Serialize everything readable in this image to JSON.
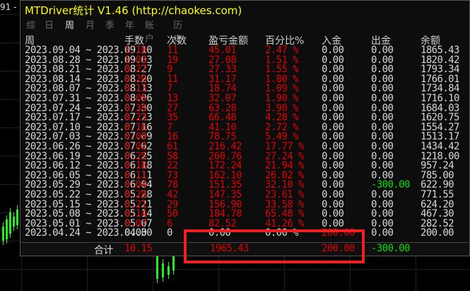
{
  "price_label": "91 -",
  "title": "MTDriver统计 V1.46  (http://chaokes.com)",
  "tabs": [
    {
      "label": "综",
      "active": false
    },
    {
      "label": "日",
      "active": false
    },
    {
      "label": "周",
      "active": true
    },
    {
      "label": "月",
      "active": false
    },
    {
      "label": "季",
      "active": false
    },
    {
      "label": "年",
      "active": false
    },
    {
      "label": "账户",
      "active": false
    },
    {
      "label": "历史",
      "active": false
    }
  ],
  "columns": [
    "周",
    "手数",
    "次数",
    "盈亏金额",
    "百分比%",
    "入金",
    "出金",
    "余额"
  ],
  "rows": [
    {
      "week": "2023.09.04 ~ 2023.09.10",
      "lots": "1.10",
      "count": "11",
      "pnl": "45.01",
      "pct": "2.47 %",
      "dep": "0.00",
      "wd": "0.00",
      "bal": "1865.43"
    },
    {
      "week": "2023.08.28 ~ 2023.09.03",
      "lots": "1.03",
      "count": "19",
      "pnl": "27.08",
      "pct": "1.51 %",
      "dep": "0.00",
      "wd": "0.00",
      "bal": "1820.42"
    },
    {
      "week": "2023.08.21 ~ 2023.08.27",
      "lots": "0.27",
      "count": "9",
      "pnl": "27.33",
      "pct": "1.55 %",
      "dep": "0.00",
      "wd": "0.00",
      "bal": "1793.34"
    },
    {
      "week": "2023.08.14 ~ 2023.08.20",
      "lots": "0.20",
      "count": "11",
      "pnl": "31.17",
      "pct": "1.80 %",
      "dep": "0.00",
      "wd": "0.00",
      "bal": "1766.01"
    },
    {
      "week": "2023.08.07 ~ 2023.08.13",
      "lots": "0.13",
      "count": "7",
      "pnl": "18.74",
      "pct": "1.09 %",
      "dep": "0.00",
      "wd": "0.00",
      "bal": "1734.84"
    },
    {
      "week": "2023.07.31 ~ 2023.08.06",
      "lots": "0.05",
      "count": "13",
      "pnl": "32.07",
      "pct": "1.90 %",
      "dep": "0.00",
      "wd": "0.00",
      "bal": "1716.10"
    },
    {
      "week": "2023.07.24 ~ 2023.07.30",
      "lots": "0.30",
      "count": "27",
      "pnl": "63.28",
      "pct": "3.90 %",
      "dep": "0.00",
      "wd": "0.00",
      "bal": "1684.03"
    },
    {
      "week": "2023.07.17 ~ 2023.07.23",
      "lots": "0.23",
      "count": "35",
      "pnl": "66.48",
      "pct": "4.28 %",
      "dep": "0.00",
      "wd": "0.00",
      "bal": "1620.75"
    },
    {
      "week": "2023.07.10 ~ 2023.07.16",
      "lots": "0.16",
      "count": "7",
      "pnl": "41.10",
      "pct": "2.72 %",
      "dep": "0.00",
      "wd": "0.00",
      "bal": "1554.27"
    },
    {
      "week": "2023.07.03 ~ 2023.07.09",
      "lots": "0.09",
      "count": "16",
      "pnl": "78.75",
      "pct": "5.49 %",
      "dep": "0.00",
      "wd": "0.00",
      "bal": "1513.17"
    },
    {
      "week": "2023.06.26 ~ 2023.07.02",
      "lots": "0.02",
      "count": "61",
      "pnl": "216.42",
      "pct": "17.77 %",
      "dep": "0.00",
      "wd": "0.00",
      "bal": "1434.42"
    },
    {
      "week": "2023.06.19 ~ 2023.06.25",
      "lots": "0.25",
      "count": "58",
      "pnl": "260.76",
      "pct": "27.24 %",
      "dep": "0.00",
      "wd": "0.00",
      "bal": "1218.00"
    },
    {
      "week": "2023.06.12 ~ 2023.06.18",
      "lots": "0.18",
      "count": "22",
      "pnl": "172.24",
      "pct": "21.94 %",
      "dep": "0.00",
      "wd": "0.00",
      "bal": "957.24"
    },
    {
      "week": "2023.06.05 ~ 2023.06.11",
      "lots": "0.11",
      "count": "73",
      "pnl": "162.10",
      "pct": "26.02 %",
      "dep": "0.00",
      "wd": "0.00",
      "bal": "785.00"
    },
    {
      "week": "2023.05.29 ~ 2023.06.04",
      "lots": "0.04",
      "count": "78",
      "pnl": "151.35",
      "pct": "32.10 %",
      "dep": "0.00",
      "wd": "-300.00",
      "bal": "622.90"
    },
    {
      "week": "2023.05.22 ~ 2023.05.28",
      "lots": "0.28",
      "count": "42",
      "pnl": "147.35",
      "pct": "23.61 %",
      "dep": "0.00",
      "wd": "0.00",
      "bal": "771.55"
    },
    {
      "week": "2023.05.15 ~ 2023.05.21",
      "lots": "0.21",
      "count": "29",
      "pnl": "156.90",
      "pct": "33.58 %",
      "dep": "0.00",
      "wd": "0.00",
      "bal": "624.20"
    },
    {
      "week": "2023.05.08 ~ 2023.05.14",
      "lots": "0.14",
      "count": "50",
      "pnl": "184.78",
      "pct": "65.48 %",
      "dep": "0.00",
      "wd": "0.00",
      "bal": "467.30"
    },
    {
      "week": "2023.05.01 ~ 2023.05.07",
      "lots": "0.07",
      "count": "6",
      "pnl": "82.52",
      "pct": "41.26 %",
      "dep": "0.00",
      "wd": "0.00",
      "bal": "282.52"
    },
    {
      "week": "2023.04.24 ~ 2023.04.30",
      "lots": "0.00",
      "count": "0",
      "pnl": "0.00",
      "pct": "0.00 %",
      "dep": "200.00",
      "wd": "0.00",
      "bal": "200.00"
    }
  ],
  "totals": {
    "label": "合计",
    "lots": "10.15",
    "pnl": "1965.43",
    "dep": "200.00",
    "wd": "-300.00"
  },
  "colors": {
    "title": "#ffff00",
    "profit": "#e00000",
    "withdraw": "#00e000",
    "highlight": "#f02020"
  }
}
